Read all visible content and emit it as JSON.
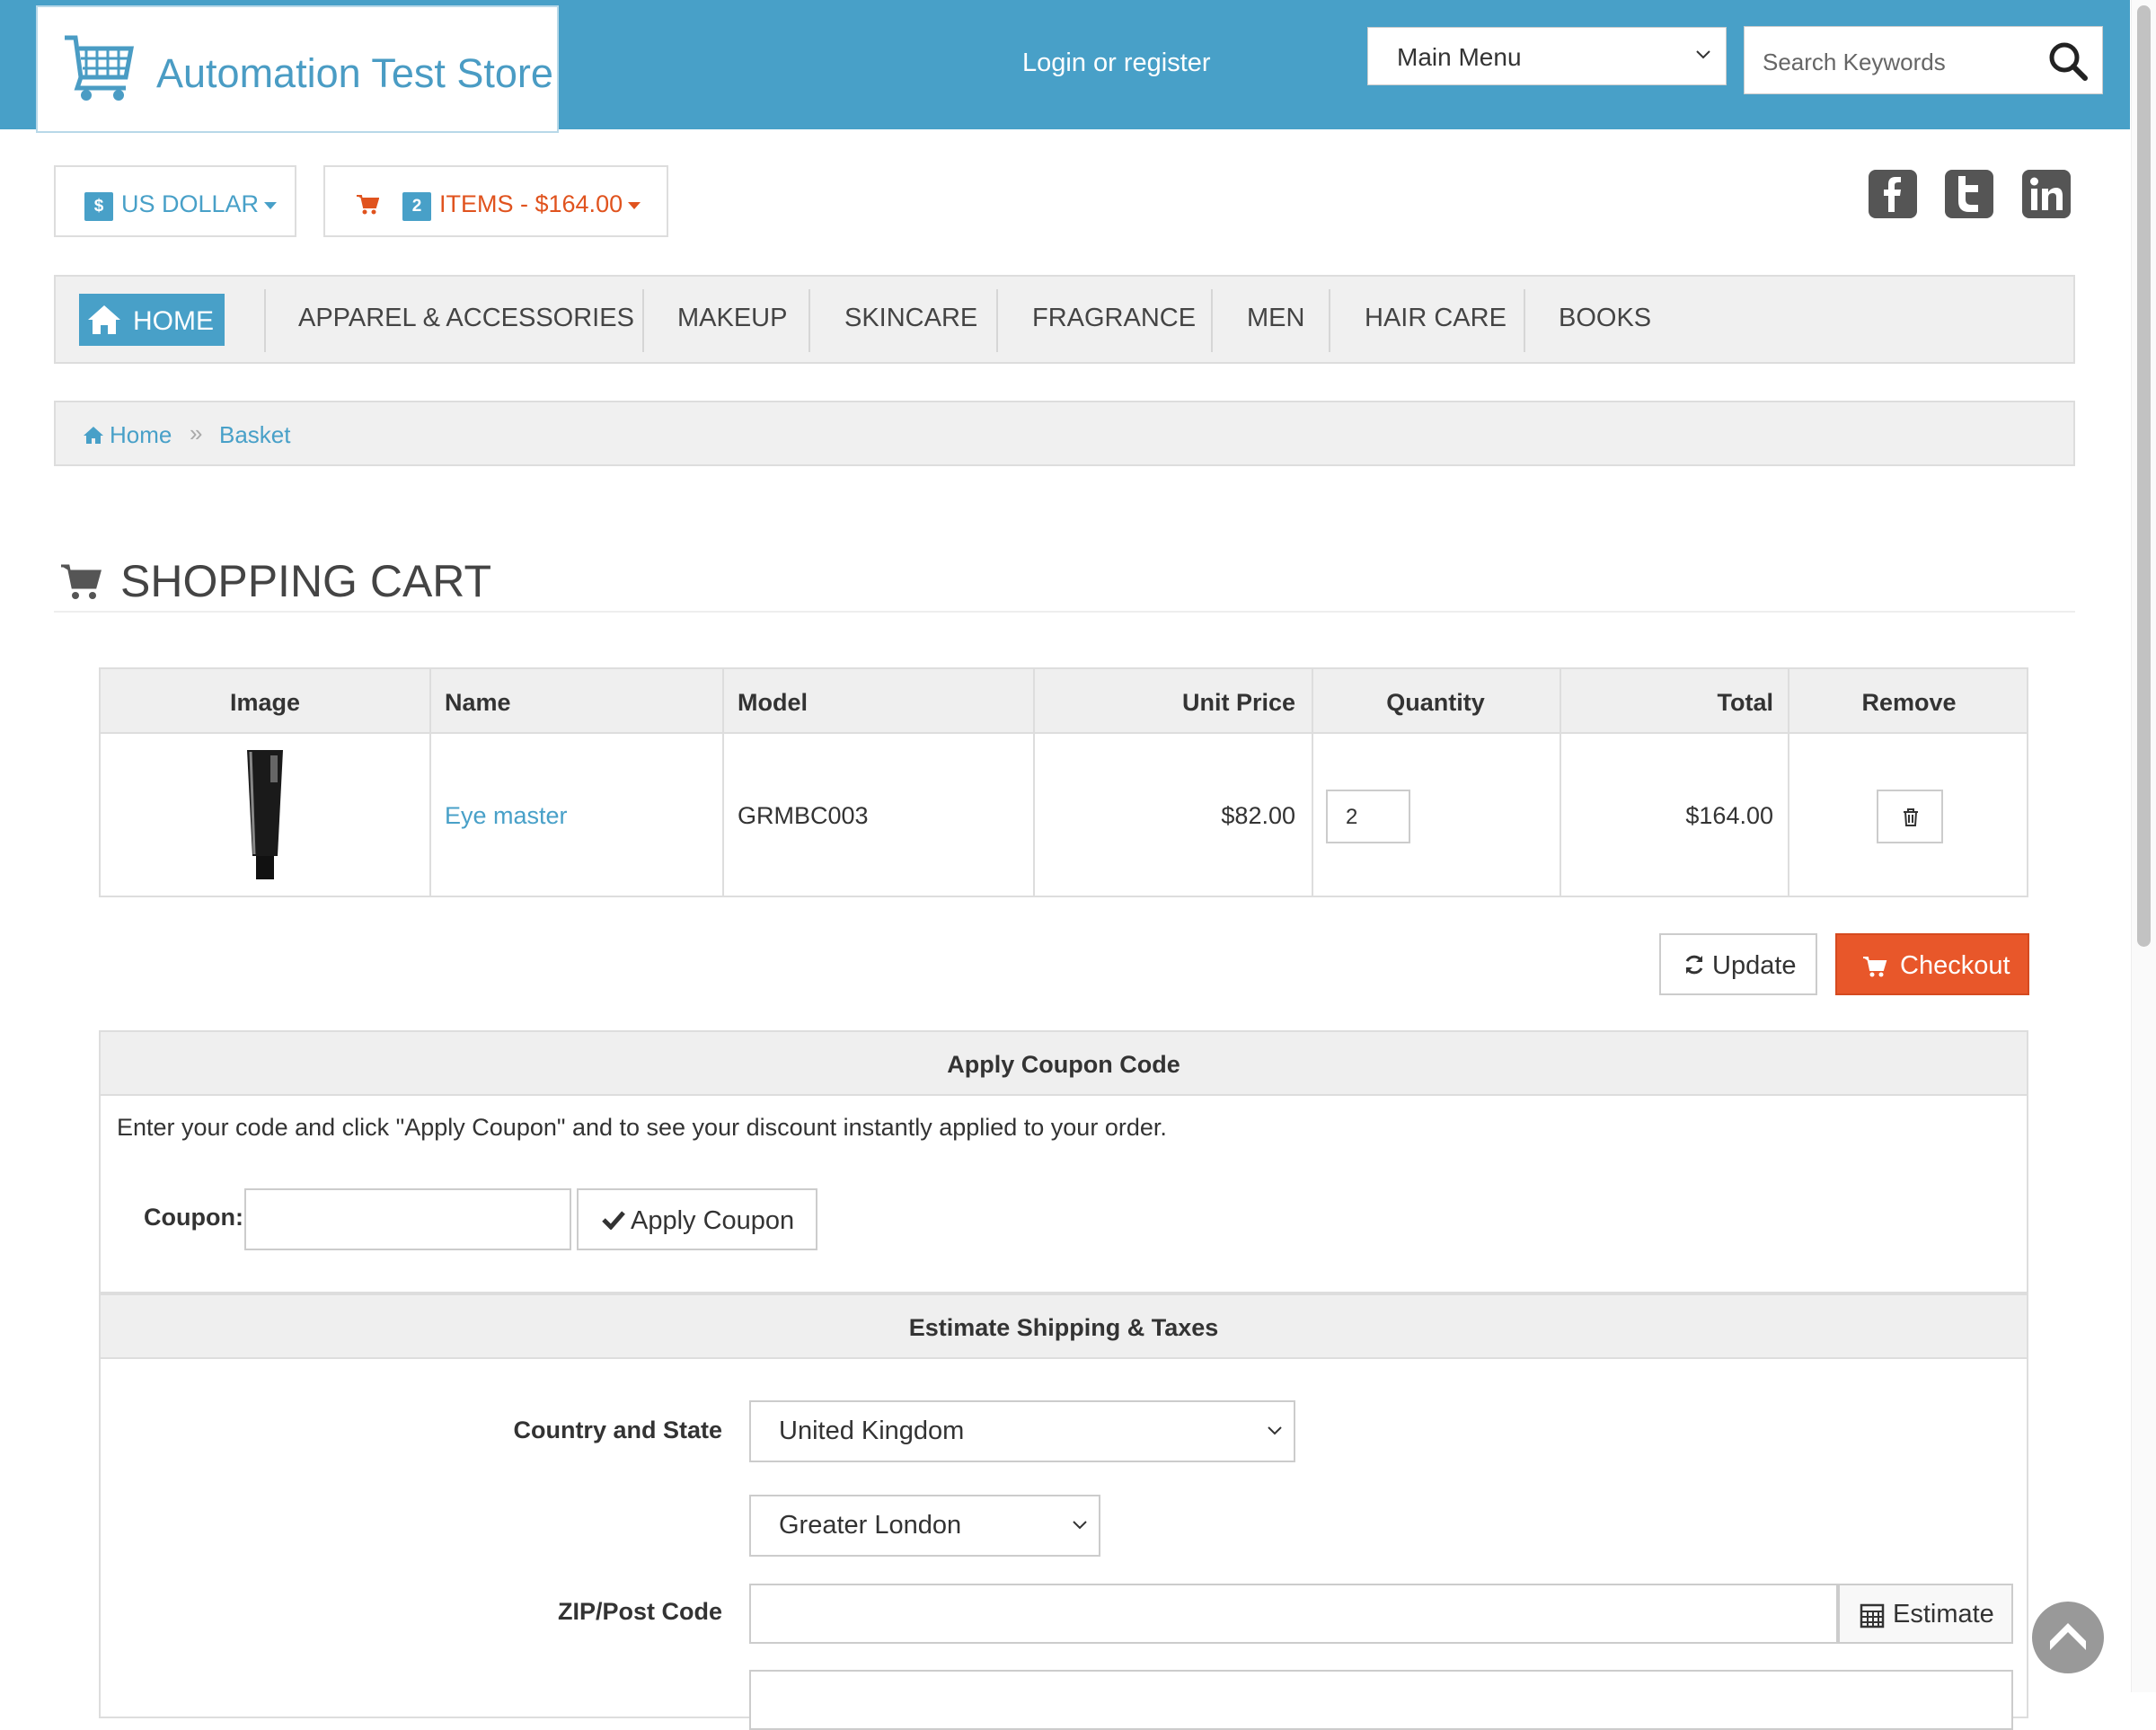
{
  "header": {
    "store_name": "Automation Test Store",
    "login_link": "Login or register",
    "main_menu": "Main Menu",
    "search_placeholder": "Search Keywords"
  },
  "currency": {
    "symbol": "$",
    "label": "US DOLLAR"
  },
  "cart_summary": {
    "count": "2",
    "label": "ITEMS - $164.00"
  },
  "social": [
    "facebook-icon",
    "twitter-icon",
    "linkedin-icon"
  ],
  "nav": {
    "home": "HOME",
    "items": [
      "APPAREL & ACCESSORIES",
      "MAKEUP",
      "SKINCARE",
      "FRAGRANCE",
      "MEN",
      "HAIR CARE",
      "BOOKS"
    ]
  },
  "breadcrumb": {
    "home": "Home",
    "separator": "»",
    "current": "Basket"
  },
  "page_title": "SHOPPING CART",
  "cart_table": {
    "headers": [
      "Image",
      "Name",
      "Model",
      "Unit Price",
      "Quantity",
      "Total",
      "Remove"
    ],
    "rows": [
      {
        "name": "Eye master",
        "model": "GRMBC003",
        "unit_price": "$82.00",
        "quantity": "2",
        "total": "$164.00"
      }
    ]
  },
  "actions": {
    "update": "Update",
    "checkout": "Checkout"
  },
  "coupon": {
    "title": "Apply Coupon Code",
    "description": "Enter your code and click \"Apply Coupon\" and to see your discount instantly applied to your order.",
    "label": "Coupon:",
    "button": "Apply Coupon"
  },
  "shipping": {
    "title": "Estimate Shipping & Taxes",
    "country_label": "Country and State",
    "country": "United Kingdom",
    "region": "Greater London",
    "zip_label": "ZIP/Post Code",
    "estimate_button": "Estimate"
  },
  "colors": {
    "brand_blue": "#48a0c8",
    "checkout_orange": "#e8572a",
    "cart_orange": "#e0531e"
  }
}
